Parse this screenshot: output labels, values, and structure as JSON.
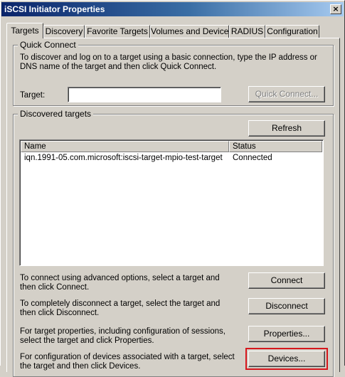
{
  "window": {
    "title": "iSCSI Initiator Properties",
    "close_symbol": "×"
  },
  "tabs": [
    {
      "label": "Targets",
      "active": true
    },
    {
      "label": "Discovery"
    },
    {
      "label": "Favorite Targets"
    },
    {
      "label": "Volumes and Devices"
    },
    {
      "label": "RADIUS"
    },
    {
      "label": "Configuration"
    }
  ],
  "quick_connect": {
    "group_label": "Quick Connect",
    "description": "To discover and log on to a target using a basic connection, type the IP address or DNS name of the target and then click Quick Connect.",
    "target_label": "Target:",
    "target_value": "",
    "button_label": "Quick Connect...",
    "button_disabled": true
  },
  "discovered": {
    "group_label": "Discovered targets",
    "refresh_label": "Refresh",
    "columns": [
      "Name",
      "Status"
    ],
    "rows": [
      {
        "name": "iqn.1991-05.com.microsoft:iscsi-target-mpio-test-target",
        "status": "Connected"
      }
    ]
  },
  "actions": [
    {
      "text": "To connect using advanced options, select a target and then click Connect.",
      "button": "Connect"
    },
    {
      "text": "To completely disconnect a target, select the target and then click Disconnect.",
      "button": "Disconnect"
    },
    {
      "text": "For target properties, including configuration of sessions, select the target and click Properties.",
      "button": "Properties..."
    },
    {
      "text": "For configuration of devices associated with a target, select the target and then click Devices.",
      "button": "Devices...",
      "highlighted": true
    }
  ],
  "colors": {
    "highlight": "#d6161c",
    "titlebar_start": "#0a246a",
    "titlebar_end": "#a6caf0"
  }
}
